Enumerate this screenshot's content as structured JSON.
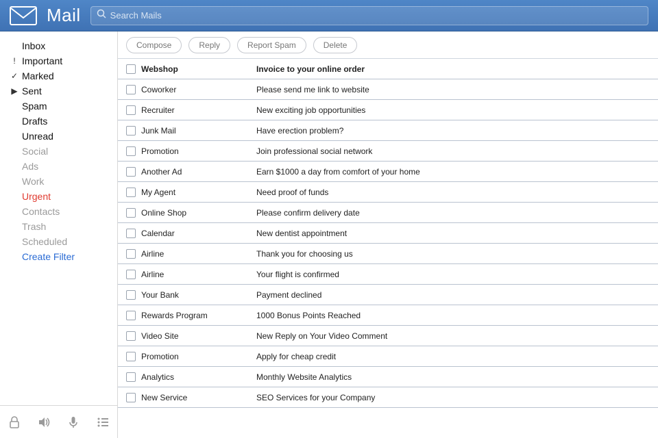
{
  "app": {
    "title": "Mail"
  },
  "search": {
    "placeholder": "Search Mails"
  },
  "toolbar": {
    "compose": "Compose",
    "reply": "Reply",
    "report_spam": "Report Spam",
    "delete": "Delete"
  },
  "sidebar": {
    "items": [
      {
        "label": "Inbox",
        "icon": "",
        "style": "normal"
      },
      {
        "label": "Important",
        "icon": "bang",
        "style": "normal"
      },
      {
        "label": "Marked",
        "icon": "check",
        "style": "normal"
      },
      {
        "label": "Sent",
        "icon": "caret",
        "style": "normal"
      },
      {
        "label": "Spam",
        "icon": "",
        "style": "normal"
      },
      {
        "label": "Drafts",
        "icon": "",
        "style": "normal"
      },
      {
        "label": "Unread",
        "icon": "",
        "style": "normal"
      },
      {
        "label": "Social",
        "icon": "",
        "style": "dim"
      },
      {
        "label": "Ads",
        "icon": "",
        "style": "dim"
      },
      {
        "label": "Work",
        "icon": "",
        "style": "dim"
      },
      {
        "label": "Urgent",
        "icon": "",
        "style": "urgent"
      },
      {
        "label": "Contacts",
        "icon": "",
        "style": "dim"
      },
      {
        "label": "Trash",
        "icon": "",
        "style": "dim"
      },
      {
        "label": "Scheduled",
        "icon": "",
        "style": "dim"
      },
      {
        "label": "Create Filter",
        "icon": "",
        "style": "link"
      }
    ]
  },
  "messages": [
    {
      "sender": "Webshop",
      "subject": "Invoice to your online order",
      "unread": true
    },
    {
      "sender": "Coworker",
      "subject": "Please send me link to website",
      "unread": false
    },
    {
      "sender": "Recruiter",
      "subject": "New exciting job opportunities",
      "unread": false
    },
    {
      "sender": "Junk Mail",
      "subject": "Have erection problem?",
      "unread": false
    },
    {
      "sender": "Promotion",
      "subject": "Join professional social network",
      "unread": false
    },
    {
      "sender": "Another Ad",
      "subject": "Earn $1000 a day from comfort of your home",
      "unread": false
    },
    {
      "sender": "My Agent",
      "subject": "Need proof of funds",
      "unread": false
    },
    {
      "sender": "Online Shop",
      "subject": "Please confirm delivery date",
      "unread": false
    },
    {
      "sender": "Calendar",
      "subject": "New dentist appointment",
      "unread": false
    },
    {
      "sender": "Airline",
      "subject": "Thank you for choosing us",
      "unread": false
    },
    {
      "sender": "Airline",
      "subject": "Your flight is confirmed",
      "unread": false
    },
    {
      "sender": "Your Bank",
      "subject": "Payment declined",
      "unread": false
    },
    {
      "sender": "Rewards Program",
      "subject": "1000 Bonus Points Reached",
      "unread": false
    },
    {
      "sender": "Video Site",
      "subject": "New Reply on Your Video Comment",
      "unread": false
    },
    {
      "sender": "Promotion",
      "subject": "Apply for cheap credit",
      "unread": false
    },
    {
      "sender": "Analytics",
      "subject": "Monthly Website Analytics",
      "unread": false
    },
    {
      "sender": "New Service",
      "subject": "SEO Services for your Company",
      "unread": false
    }
  ]
}
